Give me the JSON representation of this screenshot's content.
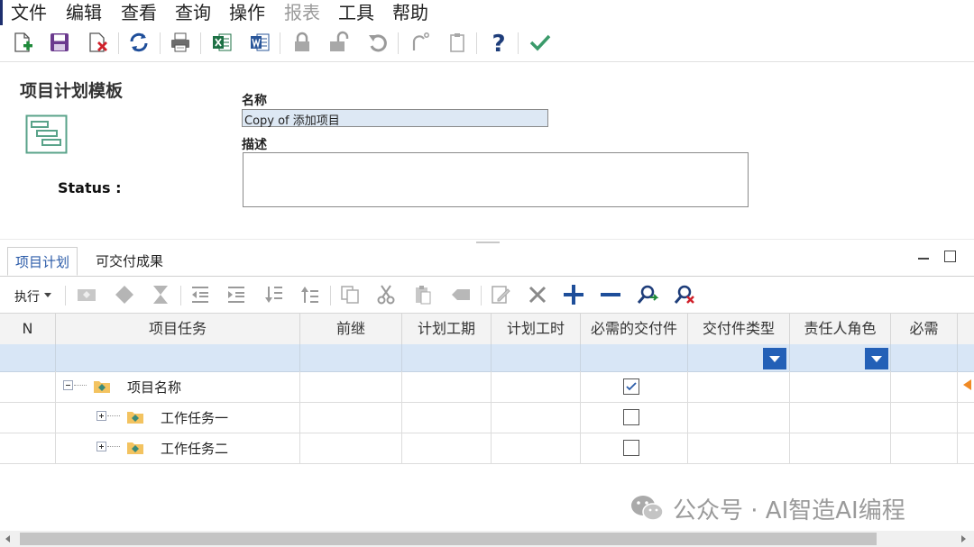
{
  "menu": [
    "文件",
    "编辑",
    "查看",
    "查询",
    "操作",
    "报表",
    "工具",
    "帮助"
  ],
  "toolbar": {
    "icons": [
      "new-icon",
      "save-icon",
      "close-doc-icon",
      "refresh-icon",
      "print-icon",
      "excel-icon",
      "word-icon",
      "lock-icon",
      "unlock-icon",
      "undo-icon",
      "redo-icon",
      "paste-icon",
      "help-icon",
      "check-icon"
    ]
  },
  "form": {
    "title": "项目计划模板",
    "status_label": "Status :",
    "name_label": "名称",
    "name_value": "Copy of 添加项目",
    "desc_label": "描述",
    "desc_value": ""
  },
  "tabs": [
    "项目计划",
    "可交付成果"
  ],
  "grid_toolbar": {
    "execute_label": "执行"
  },
  "grid": {
    "columns": [
      "N",
      "项目任务",
      "前继",
      "计划工期",
      "计划工时",
      "必需的交付件",
      "交付件类型",
      "责任人角色",
      "必需"
    ],
    "rows": [
      {
        "task": "项目名称",
        "required_deliverable": true
      },
      {
        "task": "工作任务一",
        "required_deliverable": false
      },
      {
        "task": "工作任务二",
        "required_deliverable": false
      }
    ]
  },
  "watermark": "公众号 · AI智造AI编程",
  "colors": {
    "accent": "#2360b7",
    "filter_row": "#d8e6f6",
    "header_bg": "#f3f3f3"
  }
}
